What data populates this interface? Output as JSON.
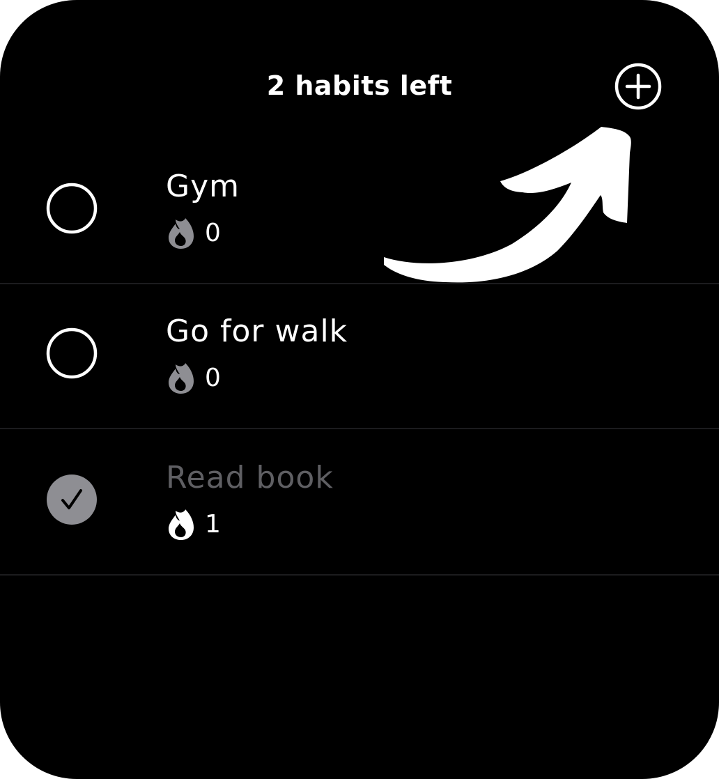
{
  "header": {
    "title": "2 habits left",
    "add_icon": "plus-circle-icon"
  },
  "annotation": {
    "icon": "curved-arrow-icon",
    "color": "#ffffff"
  },
  "habits": [
    {
      "name": "Gym",
      "streak": "0",
      "completed": false,
      "flame_color": "#8e8e93"
    },
    {
      "name": "Go for walk",
      "streak": "0",
      "completed": false,
      "flame_color": "#8e8e93"
    },
    {
      "name": "Read book",
      "streak": "1",
      "completed": true,
      "flame_color": "#ffffff"
    }
  ],
  "colors": {
    "background": "#000000",
    "text": "#ffffff",
    "completed_text": "#5f5f63",
    "completed_check_fill": "#8e8e93",
    "divider": "#1c1c1e"
  }
}
